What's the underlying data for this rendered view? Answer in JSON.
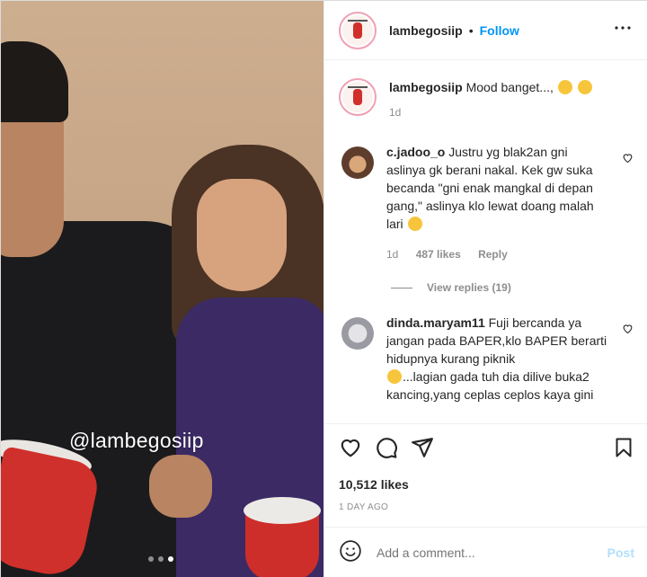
{
  "media": {
    "watermark": "@lambegosiip",
    "carousel_dots": 3,
    "active_dot": 2
  },
  "header": {
    "username": "lambegosiip",
    "separator": "•",
    "follow_label": "Follow",
    "more_icon": "more-horizontal-icon"
  },
  "caption": {
    "username": "lambegosiip",
    "text": "Mood banget...,",
    "time": "1d"
  },
  "comments": [
    {
      "username": "c.jadoo_o",
      "text": "Justru yg blak2an gni aslinya gk berani nakal. Kek gw suka becanda \"gni enak mangkal di depan gang,\" aslinya klo lewat doang malah lari",
      "time": "1d",
      "likes": "487 likes",
      "reply_label": "Reply",
      "view_replies": "View replies (19)"
    },
    {
      "username": "dinda.maryam11",
      "text": "Fuji bercanda ya jangan pada BAPER,klo BAPER berarti hidupnya kurang piknik",
      "text2": "...lagian gada tuh dia dilive buka2 kancing,yang ceplas ceplos kaya gini"
    }
  ],
  "actions": {
    "likes": "10,512 likes",
    "date": "1 DAY AGO"
  },
  "add_comment": {
    "placeholder": "Add a comment...",
    "post_label": "Post"
  },
  "colors": {
    "link": "#0095f6",
    "post_disabled": "#b2dffc",
    "muted": "#8e8e8e"
  }
}
